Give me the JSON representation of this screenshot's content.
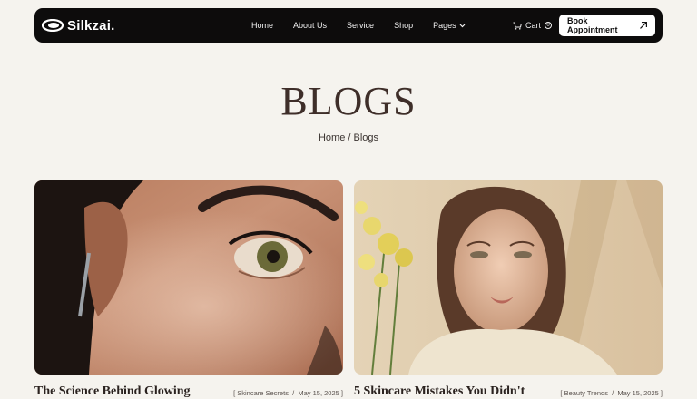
{
  "brand": {
    "name": "Silkzai."
  },
  "nav": {
    "links": [
      "Home",
      "About Us",
      "Service",
      "Shop"
    ],
    "pages_label": "Pages",
    "cart_label": "Cart",
    "cart_count": "0",
    "cta_label": "Book Appointment"
  },
  "hero": {
    "title": "BLOGS",
    "breadcrumb_home": "Home",
    "breadcrumb_separator": " / ",
    "breadcrumb_current": "Blogs"
  },
  "posts": [
    {
      "title": "The Science Behind Glowing",
      "category": "Skincare Secrets",
      "date": "May 15, 2025"
    },
    {
      "title": "5 Skincare Mistakes You Didn't",
      "category": "Beauty Trends",
      "date": "May 15, 2025"
    }
  ],
  "colors": {
    "background": "#f5f3ee",
    "navbar": "#0d0c0c",
    "title": "#3e2e29"
  }
}
